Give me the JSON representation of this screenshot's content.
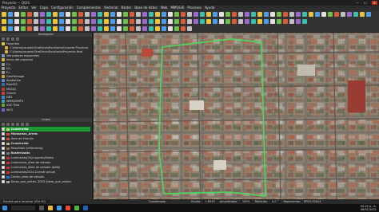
{
  "window": {
    "title": "Proyecto — QGIS"
  },
  "menu": [
    "Proyecto",
    "Editar",
    "Ver",
    "Capa",
    "Configuración",
    "Complementos",
    "Vectorial",
    "Ráster",
    "Base de datos",
    "Web",
    "MMQGIS",
    "Procesos",
    "Ayuda"
  ],
  "browser_panel": {
    "title": "Navegador",
    "items": [
      {
        "label": "Favoritos",
        "icon": "star-icon",
        "level": 0
      },
      {
        "label": "C:\\Users\\usuario\\OneDrive\\Escritorio\\Carpeta Pruyecto",
        "icon": "folder-icon",
        "level": 1
      },
      {
        "label": "C:\\Users\\usuario\\OneDrive\\Escritorio\\Proyecto final",
        "icon": "folder-icon",
        "level": 1
      },
      {
        "label": "Marcadores espaciales",
        "icon": "bookmark-icon",
        "level": 0
      },
      {
        "label": "Inicio del proyecto",
        "icon": "home-icon",
        "level": 0
      },
      {
        "label": "C:\\",
        "icon": "drive-icon",
        "level": 0
      },
      {
        "label": "D:\\",
        "icon": "drive-icon",
        "level": 0
      },
      {
        "label": "E:\\",
        "icon": "drive-icon",
        "level": 0
      },
      {
        "label": "GeoPackage",
        "icon": "geopackage-icon",
        "level": 0
      },
      {
        "label": "SpatiaLite",
        "icon": "spatialite-icon",
        "level": 0
      },
      {
        "label": "PostGIS",
        "icon": "postgis-icon",
        "level": 0
      },
      {
        "label": "MSSQL",
        "icon": "mssql-icon",
        "level": 0
      },
      {
        "label": "Oracle",
        "icon": "oracle-icon",
        "level": 0
      },
      {
        "label": "DB2",
        "icon": "db2-icon",
        "level": 0
      },
      {
        "label": "WMS/WMTS",
        "icon": "wms-icon",
        "level": 0
      },
      {
        "label": "XYZ Tiles",
        "icon": "xyz-icon",
        "level": 0
      },
      {
        "label": "WCS",
        "icon": "wcs-icon",
        "level": 0
      }
    ]
  },
  "layers_panel": {
    "title": "Capas",
    "items": [
      {
        "label": "Construida",
        "selected": true,
        "italic": true,
        "bold": true,
        "color": "#d9c27a"
      },
      {
        "label": "Manzanas_Areas",
        "selected": false,
        "italic": true,
        "bold": true,
        "color": "#d04a3a"
      },
      {
        "label": "Área de Estudio",
        "selected": false,
        "italic": true,
        "bold": false,
        "color": "#d04a3a"
      },
      {
        "label": "Construida",
        "selected": false,
        "italic": true,
        "bold": true,
        "color": "#c8b080"
      },
      {
        "label": "Resultado (referencia)",
        "selected": false,
        "italic": true,
        "bold": false,
        "color": "#9a6a3a"
      },
      {
        "label": "Rasterizado",
        "selected": false,
        "italic": true,
        "bold": true,
        "color": "#7a7a7a"
      },
      {
        "label": "Luminarias(10)Lugares/Vados",
        "selected": false,
        "italic": true,
        "bold": false,
        "color": "#c93030"
      },
      {
        "label": "Luminarias_Área de estudio",
        "selected": false,
        "italic": true,
        "bold": false,
        "color": "#c93030"
      },
      {
        "label": "Luminarias_Área de estudio (AAN)",
        "selected": false,
        "italic": true,
        "bold": false,
        "color": "#c93030"
      },
      {
        "label": "Luminarias2014-Cnerde actual",
        "selected": false,
        "italic": true,
        "bold": false,
        "color": "#c93030"
      },
      {
        "label": "Centro_área de estudio",
        "selected": false,
        "italic": true,
        "bold": false,
        "color": "#2a6dd0"
      },
      {
        "label": "Áreas_que_exiten_2003  Áreas_que_exiten",
        "selected": false,
        "italic": false,
        "bold": false,
        "color": "#a0a0a0"
      }
    ]
  },
  "map": {
    "study_area_color": "#4cd95a"
  },
  "statusbar": {
    "search_placeholder": "Escriba para localizar (Ctrl+K)",
    "coordinate_label": "Coordenada",
    "coordinate": "",
    "scale_label": "Escala",
    "scale": "1:8549",
    "magnifier_label": "Amplificador",
    "magnifier": "100%",
    "rotation_label": "Rotación",
    "rotation": "0,0 °",
    "render_label": "Representar",
    "crs": "EPSG:32614"
  },
  "taskbar": {
    "search_label": "",
    "time": "05:42 p. m.",
    "date": "08/01/2021"
  }
}
